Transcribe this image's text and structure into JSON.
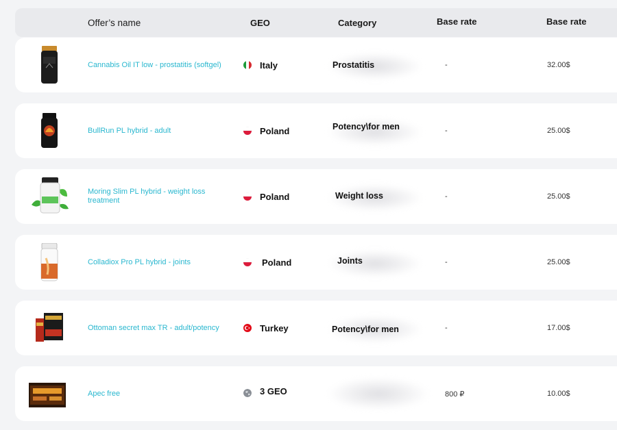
{
  "header": {
    "offer_name": "Offer’s name",
    "geo": "GEO",
    "category": "Category",
    "base_rate_1": "Base rate",
    "base_rate_2": "Base rate"
  },
  "rows": [
    {
      "name": "Cannabis Oil IT low - prostatitis (softgel)",
      "geo": "Italy",
      "flag": "italy-flag-icon",
      "category": "Prostatitis",
      "rate1": "-",
      "rate2": "32.00$"
    },
    {
      "name": "BullRun PL hybrid - adult",
      "geo": "Poland",
      "flag": "poland-flag-icon",
      "category": "Potency\\for men",
      "rate1": "-",
      "rate2": "25.00$"
    },
    {
      "name": "Moring Slim PL hybrid - weight loss treatment",
      "geo": "Poland",
      "flag": "poland-flag-icon",
      "category": "Weight loss",
      "rate1": "-",
      "rate2": "25.00$"
    },
    {
      "name": "Colladiox Pro PL hybrid - joints",
      "geo": "Poland",
      "flag": "poland-flag-icon",
      "category": "Joints",
      "rate1": "-",
      "rate2": "25.00$"
    },
    {
      "name": "Ottoman secret max TR - adult/potency",
      "geo": "Turkey",
      "flag": "turkey-flag-icon",
      "category": "Potency\\for men",
      "rate1": "-",
      "rate2": "17.00$"
    },
    {
      "name": "Apec free",
      "geo": "3 GEO",
      "flag": "globe-icon",
      "category": "",
      "rate1": "800 ₽",
      "rate2": "10.00$"
    }
  ],
  "colors": {
    "link": "#29b7cf",
    "header_bg": "#e9eaed",
    "row_bg": "#ffffff",
    "page_bg": "#f3f4f6"
  }
}
